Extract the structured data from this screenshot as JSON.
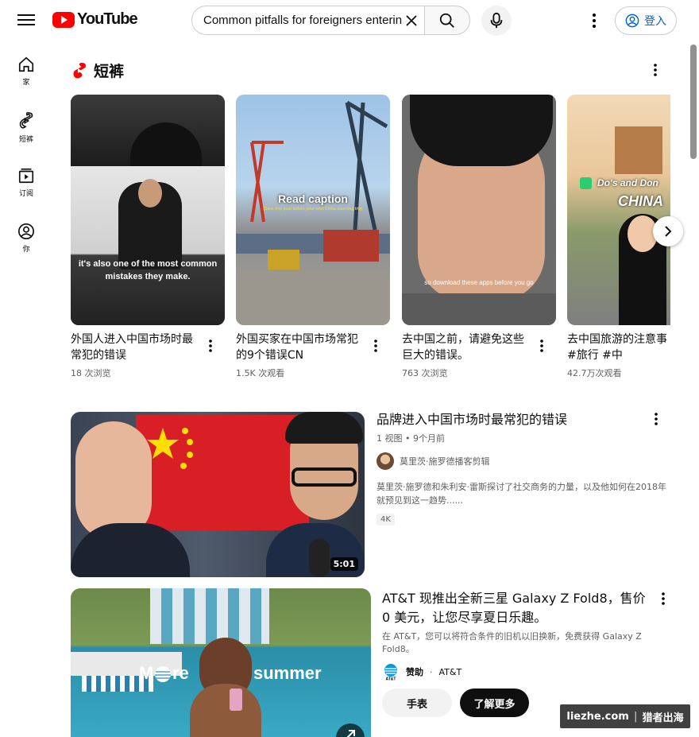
{
  "header": {
    "logo_text": "YouTube",
    "search_value": "Common pitfalls for foreigners entering",
    "signin_label": "登入"
  },
  "sidebar": {
    "items": [
      {
        "label": "家",
        "icon": "home-icon"
      },
      {
        "label": "短裤",
        "icon": "shorts-icon"
      },
      {
        "label": "订阅",
        "icon": "subscriptions-icon"
      },
      {
        "label": "你",
        "icon": "you-icon"
      }
    ]
  },
  "shorts": {
    "section_title": "短裤",
    "items": [
      {
        "title": "外国人进入中国市场时最常犯的错误",
        "views": "18 次浏览",
        "caption": "it's also one of the most common mistakes they make."
      },
      {
        "title": "外国买家在中国市场常犯的9个错误CN",
        "views": "1.5K 次观看",
        "caption": "Read caption",
        "subcaption": "(Save this post before your next China sourcing trip)"
      },
      {
        "title": "去中国之前，请避免这些巨大的错误。",
        "views": "763 次浏览",
        "caption": "so download these apps before you go"
      },
      {
        "title": "去中国旅游的注意事 ⚠️ #中国 #旅行 #中",
        "views": "42.7万次观看",
        "caption": "Do's and Don",
        "caption2": "CHINA"
      }
    ]
  },
  "video": {
    "title": "品牌进入中国市场时最常犯的错误",
    "meta": "1 视图 • 9个月前",
    "channel": "莫里茨·施罗德播客剪辑",
    "description": "莫里茨·施罗德和朱利安·雷斯探讨了社交商务的力量，以及他如何在2018年就预见到这一趋势......",
    "badge": "4K",
    "duration": "5:01"
  },
  "ad": {
    "title": "AT&T 现推出全新三星 Galaxy Z Fold8，售价 0 美元，让您尽享夏日乐趣。",
    "description": "在 AT&T，您可以将符合条件的旧机以旧换新，免费获得 Galaxy Z Fold8。",
    "sponsor_label": "赞助",
    "sponsor_name": "AT&T",
    "thumb_text_1": "M",
    "thumb_text_2": "re",
    "thumb_text_3": "summer",
    "button_watch": "手表",
    "button_learn": "了解更多"
  },
  "watermark": {
    "site": "liezhe.com",
    "name": "猎者出海"
  },
  "colors": {
    "brand_red": "#ff0000",
    "link_blue": "#065fd4",
    "text_secondary": "#606060"
  }
}
